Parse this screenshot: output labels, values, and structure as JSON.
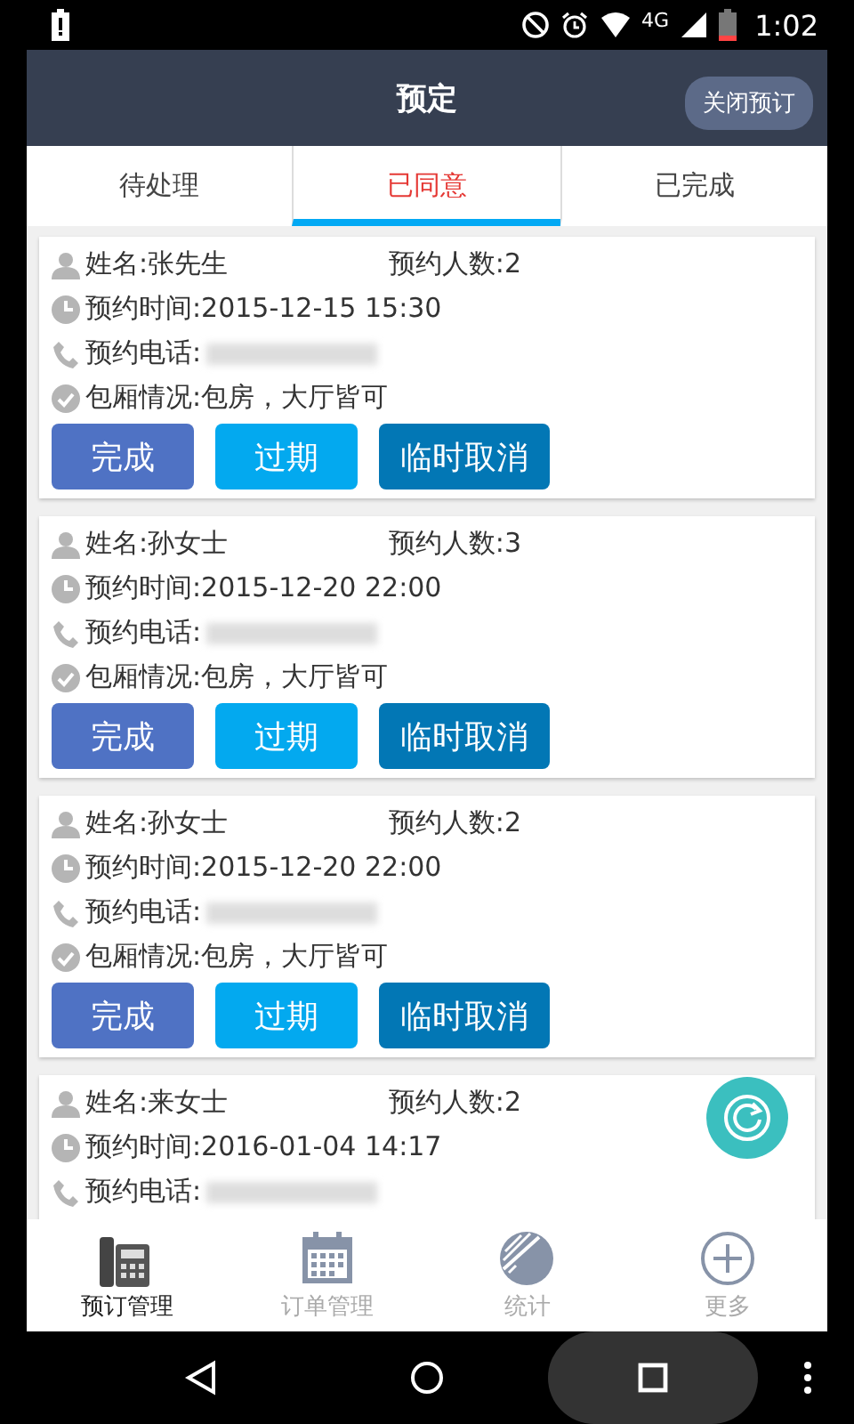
{
  "status_bar": {
    "network": "4G",
    "time": "1:02"
  },
  "header": {
    "title": "预定",
    "action": "关闭预订"
  },
  "tabs": [
    {
      "label": "待处理",
      "selected": false
    },
    {
      "label": "已同意",
      "selected": true
    },
    {
      "label": "已完成",
      "selected": false
    }
  ],
  "bookings": [
    {
      "name": "姓名:张先生",
      "party": "预约人数:2",
      "time": "预约时间:2015-12-15 15:30",
      "phone_label": "预约电话:",
      "room": "包厢情况:包房，大厅皆可",
      "buttons": [
        {
          "label": "完成",
          "kind": "complete"
        },
        {
          "label": "过期",
          "kind": "expire"
        },
        {
          "label": "临时取消",
          "kind": "cancel"
        }
      ]
    },
    {
      "name": "姓名:孙女士",
      "party": "预约人数:3",
      "time": "预约时间:2015-12-20 22:00",
      "phone_label": "预约电话:",
      "room": "包厢情况:包房，大厅皆可",
      "buttons": [
        {
          "label": "完成",
          "kind": "complete"
        },
        {
          "label": "过期",
          "kind": "expire"
        },
        {
          "label": "临时取消",
          "kind": "cancel"
        }
      ]
    },
    {
      "name": "姓名:孙女士",
      "party": "预约人数:2",
      "time": "预约时间:2015-12-20 22:00",
      "phone_label": "预约电话:",
      "room": "包厢情况:包房，大厅皆可",
      "buttons": [
        {
          "label": "完成",
          "kind": "complete"
        },
        {
          "label": "过期",
          "kind": "expire"
        },
        {
          "label": "临时取消",
          "kind": "cancel"
        }
      ]
    },
    {
      "name": "姓名:来女士",
      "party": "预约人数:2",
      "time": "预约时间:2016-01-04 14:17",
      "phone_label": "预约电话:"
    }
  ],
  "bottom_nav": [
    {
      "label": "预订管理",
      "kind": "phone",
      "selected": true
    },
    {
      "label": "订单管理",
      "kind": "calendar",
      "selected": false
    },
    {
      "label": "统计",
      "kind": "chart",
      "selected": false
    },
    {
      "label": "更多",
      "kind": "more",
      "selected": false
    }
  ]
}
